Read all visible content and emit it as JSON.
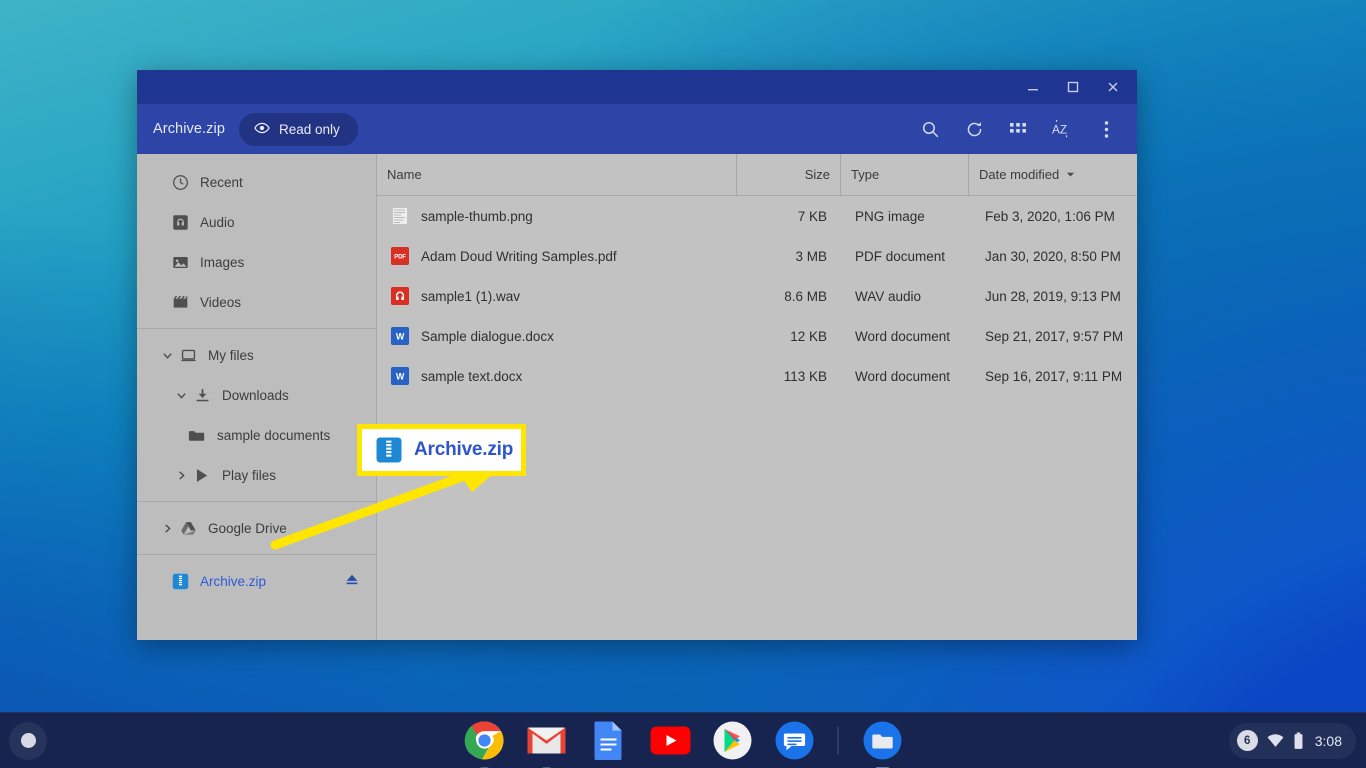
{
  "desktop": {
    "wallpaper_colors": [
      "#3fb3c6",
      "#0a6dbb",
      "#0a42b0"
    ]
  },
  "window": {
    "title": "Archive.zip",
    "readonly_label": "Read only",
    "controls": {
      "minimize": "minimize-icon",
      "maximize": "maximize-icon",
      "close": "close-icon"
    },
    "toolbar_icons": [
      "search-icon",
      "refresh-icon",
      "grid-view-icon",
      "sort-az-icon",
      "more-options-icon"
    ]
  },
  "sidebar": {
    "items": [
      {
        "label": "Recent",
        "icon": "clock-icon",
        "indent": 0,
        "twisty": "",
        "selected": false
      },
      {
        "label": "Audio",
        "icon": "audio-icon",
        "indent": 0,
        "twisty": "",
        "selected": false
      },
      {
        "label": "Images",
        "icon": "image-icon",
        "indent": 0,
        "twisty": "",
        "selected": false
      },
      {
        "label": "Videos",
        "icon": "video-icon",
        "indent": 0,
        "twisty": "",
        "selected": false
      },
      {
        "label": "My files",
        "icon": "computer-icon",
        "indent": 0,
        "twisty": "down",
        "selected": false
      },
      {
        "label": "Downloads",
        "icon": "download-icon",
        "indent": 1,
        "twisty": "down",
        "selected": false
      },
      {
        "label": "sample documents",
        "icon": "folder-icon",
        "indent": 2,
        "twisty": "",
        "selected": false
      },
      {
        "label": "Play files",
        "icon": "play-store-icon",
        "indent": 1,
        "twisty": "right",
        "selected": false
      },
      {
        "label": "Google Drive",
        "icon": "google-drive-icon",
        "indent": 0,
        "twisty": "right",
        "selected": false
      },
      {
        "label": "Archive.zip",
        "icon": "zip-icon",
        "indent": 0,
        "twisty": "",
        "selected": true,
        "eject": true
      }
    ]
  },
  "filelist": {
    "columns": [
      "Name",
      "Size",
      "Type",
      "Date modified"
    ],
    "sorted_by": "Date modified",
    "rows": [
      {
        "name": "sample-thumb.png",
        "size": "7 KB",
        "type": "PNG image",
        "date": "Feb 3, 2020, 1:06 PM",
        "icon": "thumbnail-icon"
      },
      {
        "name": "Adam Doud Writing Samples.pdf",
        "size": "3 MB",
        "type": "PDF document",
        "date": "Jan 30, 2020, 8:50 PM",
        "icon": "pdf-icon"
      },
      {
        "name": "sample1 (1).wav",
        "size": "8.6 MB",
        "type": "WAV audio",
        "date": "Jun 28, 2019, 9:13 PM",
        "icon": "wav-icon"
      },
      {
        "name": "Sample dialogue.docx",
        "size": "12 KB",
        "type": "Word document",
        "date": "Sep 21, 2017, 9:57 PM",
        "icon": "word-icon"
      },
      {
        "name": "sample text.docx",
        "size": "113 KB",
        "type": "Word document",
        "date": "Sep 16, 2017, 9:11 PM",
        "icon": "word-icon"
      }
    ]
  },
  "callout": {
    "label": "Archive.zip",
    "border_color": "#ffe600",
    "text_color": "#2e56c8"
  },
  "shelf": {
    "launcher": "launcher-button",
    "apps": [
      {
        "name": "chrome"
      },
      {
        "name": "gmail"
      },
      {
        "name": "docs"
      },
      {
        "name": "youtube"
      },
      {
        "name": "play-store"
      },
      {
        "name": "messages"
      },
      {
        "name": "files"
      }
    ],
    "tray": {
      "notification_count": "6",
      "wifi": "wifi-icon",
      "battery": "battery-icon",
      "time": "3:08"
    }
  }
}
